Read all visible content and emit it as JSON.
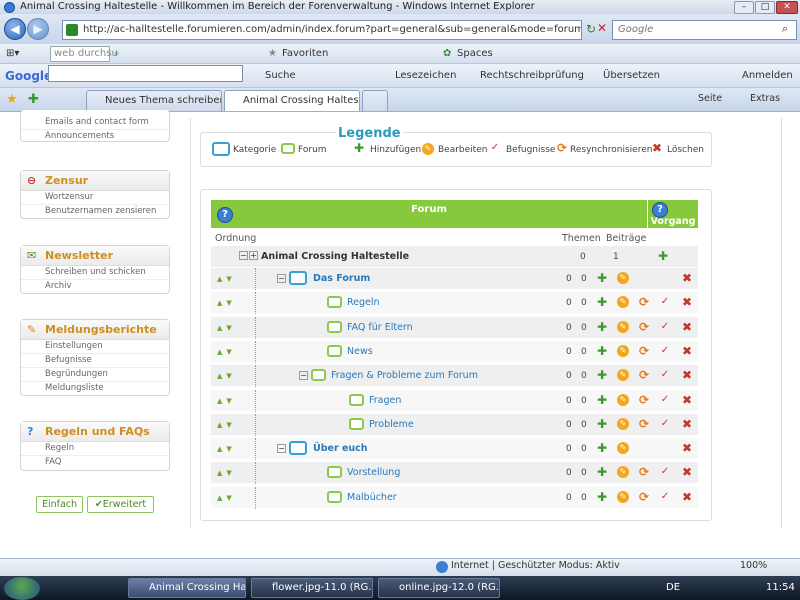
{
  "window": {
    "title": "Animal Crossing Haltestelle - Willkommen im Bereich der Forenverwaltung - Windows Internet Explorer"
  },
  "nav": {
    "url": "http://ac-halltestelle.forumieren.com/admin/index.forum?part=general&sub=general&mode=forum&extended_a",
    "search_placeholder": "Google"
  },
  "links_bar": {
    "search_placeholder": "web durchsu",
    "favorites": "Favoriten",
    "spaces": "Spaces"
  },
  "google_bar": {
    "logo": "Google",
    "suche": "Suche",
    "lesezeichen": "Lesezeichen",
    "rechtschreibung": "Rechtschreibprüfung",
    "uebersetzen": "Übersetzen",
    "anmelden": "Anmelden"
  },
  "tabs": [
    {
      "label": "Neues Thema schreiben"
    },
    {
      "label": "Animal Crossing Haltes..."
    }
  ],
  "cmdbar": {
    "seite": "Seite",
    "extras": "Extras"
  },
  "sidebar": {
    "top_links": [
      "Emails and contact form",
      "Announcements"
    ],
    "groups": [
      {
        "title": "Zensur",
        "links": [
          "Wortzensur",
          "Benutzernamen zensieren"
        ]
      },
      {
        "title": "Newsletter",
        "links": [
          "Schreiben und schicken",
          "Archiv"
        ]
      },
      {
        "title": "Meldungsberichte",
        "links": [
          "Einstellungen",
          "Befugnisse",
          "Begründungen",
          "Meldungsliste"
        ]
      },
      {
        "title": "Regeln und FAQs",
        "links": [
          "Regeln",
          "FAQ"
        ]
      }
    ],
    "btn_simple": "Einfach",
    "btn_extended": "Erweitert"
  },
  "legend": {
    "title": "Legende",
    "items": [
      "Kategorie",
      "Forum",
      "Hinzufügen",
      "Bearbeiten",
      "Befugnisse",
      "Resynchronisieren",
      "Löschen"
    ]
  },
  "table": {
    "header_forum": "Forum",
    "header_vorgang": "Vorgang",
    "col_ordnung": "Ordnung",
    "col_themen": "Themen",
    "col_beitraege": "Beiträge",
    "root": {
      "name": "Animal Crossing Haltestelle",
      "themen": "0",
      "beitraege": "1"
    },
    "rows": [
      {
        "name": "Das Forum",
        "themen": "0",
        "beitraege": "0"
      },
      {
        "name": "Regeln",
        "themen": "0",
        "beitraege": "0"
      },
      {
        "name": "FAQ für Eltern",
        "themen": "0",
        "beitraege": "0"
      },
      {
        "name": "News",
        "themen": "0",
        "beitraege": "0"
      },
      {
        "name": "Fragen & Probleme zum Forum",
        "themen": "0",
        "beitraege": "0"
      },
      {
        "name": "Fragen",
        "themen": "0",
        "beitraege": "0"
      },
      {
        "name": "Probleme",
        "themen": "0",
        "beitraege": "0"
      },
      {
        "name": "Über euch",
        "themen": "0",
        "beitraege": "0"
      },
      {
        "name": "Vorstellung",
        "themen": "0",
        "beitraege": "0"
      },
      {
        "name": "Malbücher",
        "themen": "0",
        "beitraege": "0"
      }
    ]
  },
  "status": {
    "zone": "Internet | Geschützter Modus: Aktiv",
    "zoom": "100%"
  },
  "taskbar": {
    "items": [
      "Animal Crossing Ha...",
      "flower.jpg-11.0 (RG...",
      "online.jpg-12.0 (RG..."
    ],
    "lang": "DE",
    "time": "11:54"
  }
}
